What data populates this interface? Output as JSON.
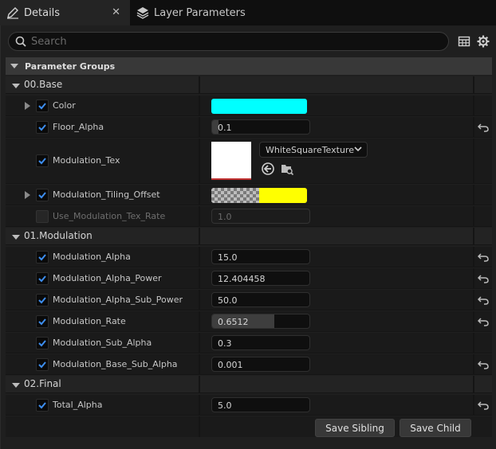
{
  "tabs": [
    {
      "label": "Details",
      "icon": "pencil-icon",
      "active": true
    },
    {
      "label": "Layer Parameters",
      "icon": "layers-icon",
      "active": false
    }
  ],
  "search": {
    "placeholder": "Search"
  },
  "toolbar": {
    "table_icon": "table-icon",
    "settings_icon": "gear-icon"
  },
  "parameter_groups_label": "Parameter Groups",
  "groups": [
    {
      "label": "00.Base"
    },
    {
      "label": "01.Modulation"
    },
    {
      "label": "02.Final"
    }
  ],
  "params": {
    "color": {
      "name": "Color",
      "value_color": "#00ffff"
    },
    "floor_alpha": {
      "name": "Floor_Alpha",
      "value": "0.1",
      "fill_fraction": 0.1
    },
    "modulation_tex": {
      "name": "Modulation_Tex",
      "texture": "WhiteSquareTexture"
    },
    "tiling_offset": {
      "name": "Modulation_Tiling_Offset",
      "value_color": "#ffff00"
    },
    "use_tex_rate": {
      "name": "Use_Modulation_Tex_Rate",
      "value": "1.0"
    },
    "mod_alpha": {
      "name": "Modulation_Alpha",
      "value": "15.0"
    },
    "mod_alpha_power": {
      "name": "Modulation_Alpha_Power",
      "value": "12.404458"
    },
    "mod_alpha_sub_power": {
      "name": "Modulation_Alpha_Sub_Power",
      "value": "50.0"
    },
    "mod_rate": {
      "name": "Modulation_Rate",
      "value": "0.6512",
      "fill_fraction": 0.6512
    },
    "mod_sub_alpha": {
      "name": "Modulation_Sub_Alpha",
      "value": "0.3"
    },
    "mod_base_sub_alpha": {
      "name": "Modulation_Base_Sub_Alpha",
      "value": "0.001"
    },
    "total_alpha": {
      "name": "Total_Alpha",
      "value": "5.0"
    }
  },
  "buttons": {
    "save_sibling": "Save Sibling",
    "save_child": "Save Child"
  }
}
